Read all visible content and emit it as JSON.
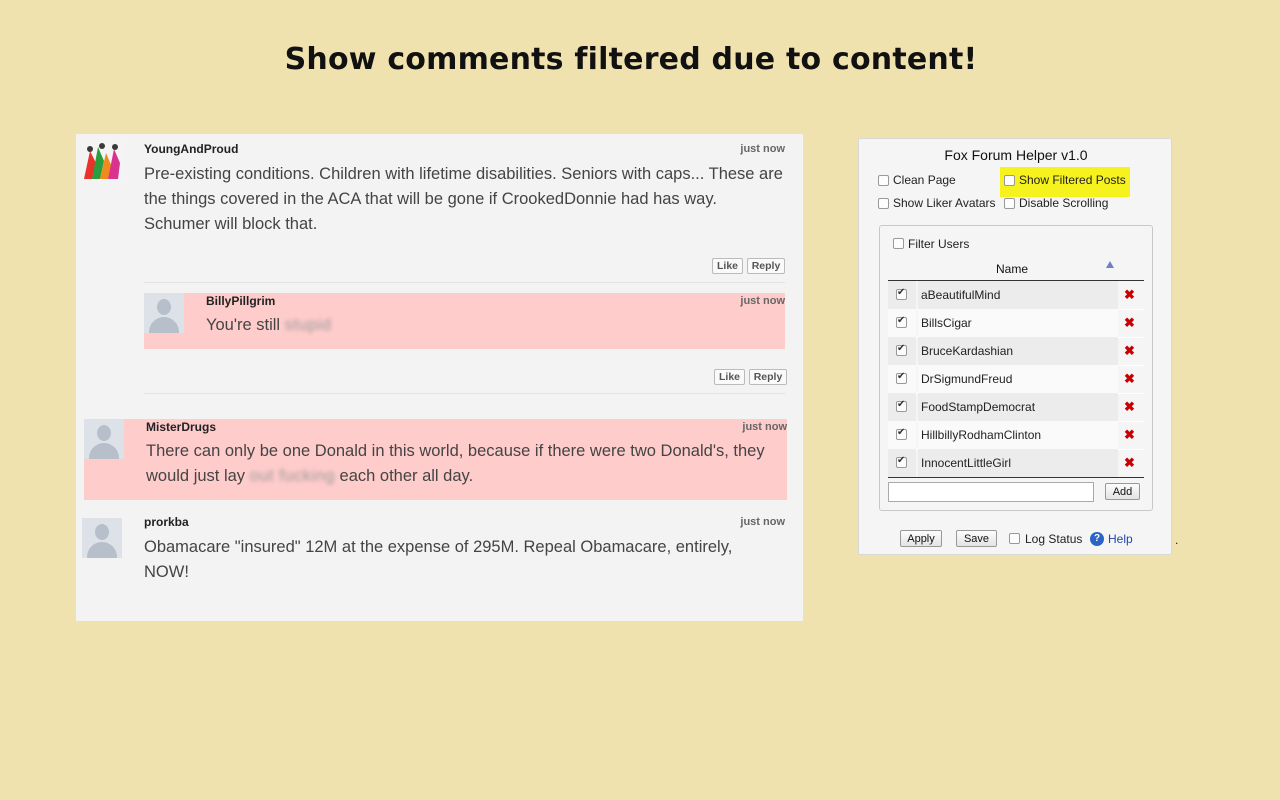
{
  "headline": "Show comments filtered due to content!",
  "comments": [
    {
      "user": "YoungAndProud",
      "time": "just now",
      "text": "Pre-existing conditions. Children with lifetime disabilities. Seniors with caps... These are the things covered in the ACA that will be gone if CrookedDonnie had has way. Schumer will block that.",
      "like": "Like",
      "reply": "Reply"
    },
    {
      "user": "BillyPillgrim",
      "time": "just now",
      "text_before": "You're still ",
      "text_filtered": "stupid",
      "like": "Like",
      "reply": "Reply"
    },
    {
      "user": "MisterDrugs",
      "time": "just now",
      "text_before": "There can only be one Donald in this world, because if there were two Donald's, they would just lay ",
      "text_filtered": "out fucking",
      "text_after": " each other all day."
    },
    {
      "user": "prorkba",
      "time": "just now",
      "text": "Obamacare \"insured\" 12M at the expense of 295M.  Repeal Obamacare, entirely, NOW!"
    }
  ],
  "helper": {
    "title": "Fox Forum Helper v1.0",
    "options": {
      "clean_page": "Clean Page",
      "show_filtered": "Show Filtered Posts",
      "show_liker_avatars": "Show Liker Avatars",
      "disable_scrolling": "Disable Scrolling"
    },
    "filter_users_label": "Filter Users",
    "name_header": "Name",
    "sort_icon": "triangle-up-icon",
    "users": [
      "aBeautifulMind",
      "BillsCigar",
      "BruceKardashian",
      "DrSigmundFreud",
      "FoodStampDemocrat",
      "HillbillyRodhamClinton",
      "InnocentLittleGirl"
    ],
    "add_label": "Add",
    "apply_label": "Apply",
    "save_label": "Save",
    "log_status_label": "Log Status",
    "help_label": "Help",
    "help_icon_glyph": "?"
  },
  "trailing_dot": ".",
  "colors": {
    "background": "#f0e2ae",
    "filtered_comment": "#ffcccc",
    "highlight": "#f6f21e",
    "remove_x": "#cc0000"
  }
}
